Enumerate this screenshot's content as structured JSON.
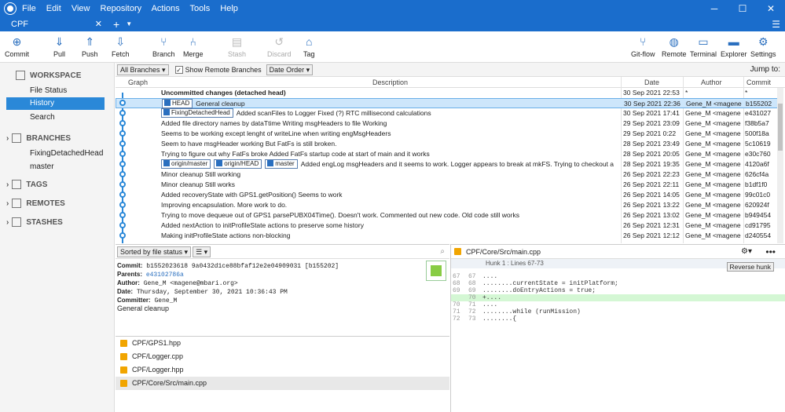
{
  "menu": [
    "File",
    "Edit",
    "View",
    "Repository",
    "Actions",
    "Tools",
    "Help"
  ],
  "tab": {
    "label": "CPF"
  },
  "toolbar": {
    "commit": "Commit",
    "pull": "Pull",
    "push": "Push",
    "fetch": "Fetch",
    "branch": "Branch",
    "merge": "Merge",
    "stash": "Stash",
    "discard": "Discard",
    "tag": "Tag",
    "gitflow": "Git-flow",
    "remote": "Remote",
    "terminal": "Terminal",
    "explorer": "Explorer",
    "settings": "Settings"
  },
  "sidebar": {
    "workspace": "WORKSPACE",
    "file_status": "File Status",
    "history": "History",
    "search": "Search",
    "branches": "BRANCHES",
    "branch1": "FixingDetachedHead",
    "branch2": "master",
    "tags": "TAGS",
    "remotes": "REMOTES",
    "stashes": "STASHES"
  },
  "filter": {
    "branches": "All Branches",
    "show_remote": "Show Remote Branches",
    "order": "Date Order",
    "jump": "Jump to:"
  },
  "columns": {
    "graph": "Graph",
    "description": "Description",
    "date": "Date",
    "author": "Author",
    "commit": "Commit"
  },
  "rows": [
    {
      "desc": "Uncommitted changes (detached head)",
      "date": "30 Sep 2021 22:53",
      "author": "*",
      "commit": "*"
    },
    {
      "desc": "General cleanup",
      "date": "30 Sep 2021 22:36",
      "author": "Gene_M <magene",
      "commit": "b155202"
    },
    {
      "desc": "Added scanFiles to Logger Fixed (?) RTC millisecond calculations",
      "date": "30 Sep 2021 17:41",
      "author": "Gene_M <magene",
      "commit": "e431027"
    },
    {
      "desc": "Added file directory names by dataTtime Writing msgHeaders to file Working",
      "date": "29 Sep 2021 23:09",
      "author": "Gene_M <magene",
      "commit": "f38b5a7"
    },
    {
      "desc": "Seems to be working except lenght of writeLine when writing engMsgHeaders",
      "date": "29 Sep 2021 0:22",
      "author": "Gene_M <magene",
      "commit": "500f18a"
    },
    {
      "desc": "Seem to have msgHeader working But FatFs is still broken.",
      "date": "28 Sep 2021 23:49",
      "author": "Gene_M <magene",
      "commit": "5c10619"
    },
    {
      "desc": "Trying to figure out why FatFs broke Added FatFs startup code at start of main and it works",
      "date": "28 Sep 2021 20:05",
      "author": "Gene_M <magene",
      "commit": "e30c760"
    },
    {
      "desc": "Added engLog msgHeaders and it seems to work. Logger appears to break at mkFS. Trying to checkout a",
      "date": "28 Sep 2021 19:35",
      "author": "Gene_M <magene",
      "commit": "4120a6f"
    },
    {
      "desc": "Minor cleanup Still working",
      "date": "26 Sep 2021 22:23",
      "author": "Gene_M <magene",
      "commit": "626cf4a"
    },
    {
      "desc": "Minor cleanup Still works",
      "date": "26 Sep 2021 22:11",
      "author": "Gene_M <magene",
      "commit": "b1df1f0"
    },
    {
      "desc": "Added recoveryState with GPS1.getPosition() Seems to work",
      "date": "26 Sep 2021 14:05",
      "author": "Gene_M <magene",
      "commit": "99c01c0"
    },
    {
      "desc": "Improving encapsulation.  More work to do.",
      "date": "26 Sep 2021 13:22",
      "author": "Gene_M <magene",
      "commit": "620924f"
    },
    {
      "desc": "Trying to move dequeue out of GPS1 parsePUBX04Time().  Doesn't work. Commented out new code. Old code still works",
      "date": "26 Sep 2021 13:02",
      "author": "Gene_M <magene",
      "commit": "b949454"
    },
    {
      "desc": "Added nextAction to initProfileState actions to preserve some history",
      "date": "26 Sep 2021 12:31",
      "author": "Gene_M <magene",
      "commit": "cd91795"
    },
    {
      "desc": "Making initProfileState actions non-blocking",
      "date": "26 Sep 2021 12:12",
      "author": "Gene_M <magene",
      "commit": "d240554"
    }
  ],
  "badges": {
    "head": "HEAD",
    "fixing": "FixingDetachedHead",
    "origin_master": "origin/master",
    "origin_head": "origin/HEAD",
    "master": "master"
  },
  "bottom_left": {
    "sort": "Sorted by file status",
    "commit_label": "Commit:",
    "commit_val": "b1552023618 9a0432d1ce88bfaf12e2e04909031 [b155202]",
    "parents_label": "Parents:",
    "parents_val": "e43102786a",
    "author_label": "Author:",
    "author_val": "Gene_M <magene@mbari.org>",
    "date_label": "Date:",
    "date_val": "Thursday, September 30, 2021 10:36:43 PM",
    "committer_label": "Committer:",
    "committer_val": "Gene_M",
    "message": "General cleanup",
    "files": [
      "CPF/GPS1.hpp",
      "CPF/Logger.cpp",
      "CPF/Logger.hpp",
      "CPF/Core/Src/main.cpp"
    ]
  },
  "bottom_right": {
    "file": "CPF/Core/Src/main.cpp",
    "hunk": "Hunk 1 : Lines 67-73",
    "reverse": "Reverse hunk",
    "lines": [
      {
        "o": "67",
        "n": "67",
        "t": "....",
        "add": false
      },
      {
        "o": "68",
        "n": "68",
        "t": "........currentState = initPlatform;",
        "add": false
      },
      {
        "o": "69",
        "n": "69",
        "t": "........doEntryActions = true;",
        "add": false
      },
      {
        "o": "",
        "n": "70",
        "t": "+....",
        "add": true
      },
      {
        "o": "70",
        "n": "71",
        "t": "....",
        "add": false
      },
      {
        "o": "71",
        "n": "72",
        "t": "........while (runMission)",
        "add": false
      },
      {
        "o": "72",
        "n": "73",
        "t": "........{",
        "add": false
      }
    ]
  }
}
